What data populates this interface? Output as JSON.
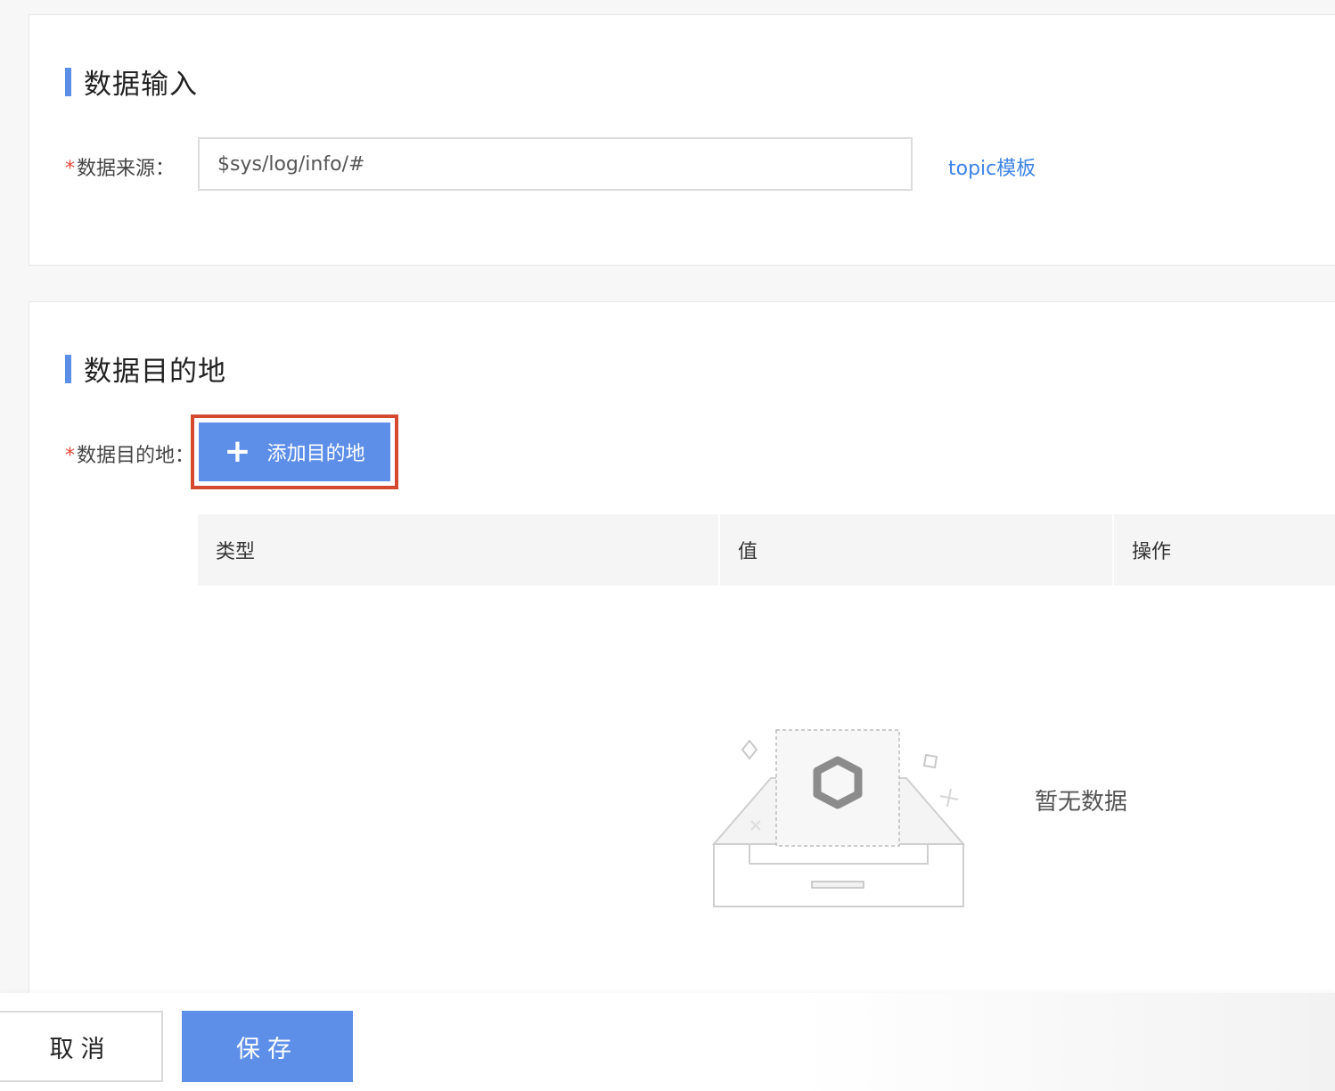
{
  "input_section": {
    "title": "数据输入",
    "source_label": "数据来源：",
    "required_mark": "*",
    "source_value": "$sys/log/info/#",
    "topic_link": "topic模板"
  },
  "dest_section": {
    "title": "数据目的地",
    "dest_label": "数据目的地：",
    "required_mark": "*",
    "add_button_icon": "plus-icon",
    "add_button_label": "添加目的地",
    "table": {
      "columns": [
        "类型",
        "值",
        "操作"
      ],
      "rows": [],
      "empty_text": "暂无数据"
    }
  },
  "footer": {
    "cancel_label": "取消",
    "save_label": "保存"
  },
  "colors": {
    "accent": "#5d8ee8",
    "link": "#3d84e6",
    "required": "#e64a3b",
    "highlight_border": "#d54a2f"
  }
}
